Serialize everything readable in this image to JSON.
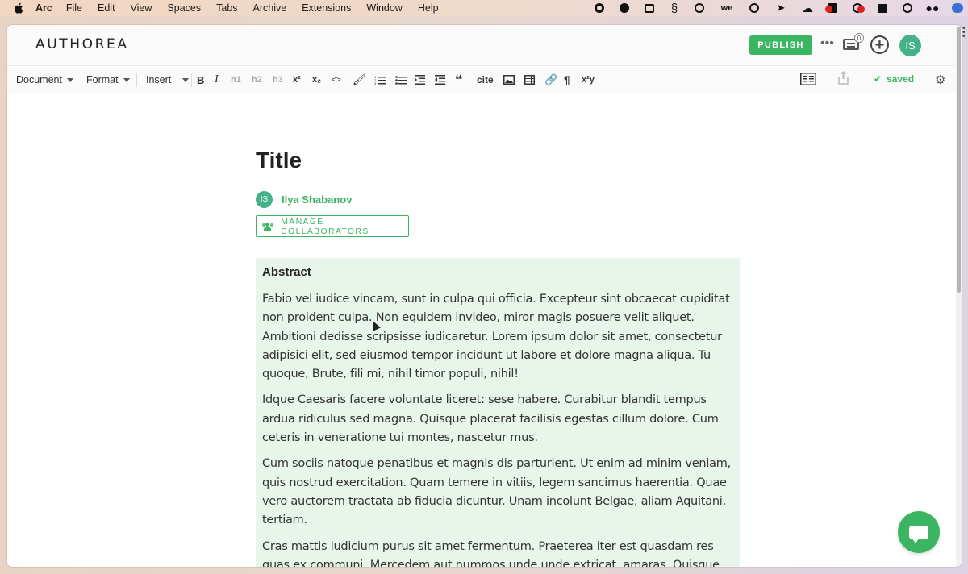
{
  "menubar": {
    "app_name": "Arc",
    "items": [
      "File",
      "Edit",
      "View",
      "Spaces",
      "Tabs",
      "Archive",
      "Extensions",
      "Window",
      "Help"
    ]
  },
  "header": {
    "logo": "AUTHOREA",
    "publish_label": "PUBLISH",
    "more_label": "•••",
    "comments_count": "0",
    "add_label": "+",
    "avatar_initials": "IS"
  },
  "toolbar": {
    "document_label": "Document",
    "format_label": "Format",
    "insert_label": "Insert",
    "bold": "B",
    "italic": "I",
    "h1": "h1",
    "h2": "h2",
    "h3": "h3",
    "superscript": "x²",
    "subscript": "x₂",
    "code": "<>",
    "cite": "cite",
    "pilcrow": "¶",
    "math": "x²y",
    "saved_label": "saved"
  },
  "document": {
    "title": "Title",
    "author_initials": "IS",
    "author_name": "Ilya Shabanov",
    "collaborators_label": "MANAGE COLLABORATORS",
    "abstract_heading": "Abstract",
    "paragraphs": [
      "Fabio vel iudice vincam, sunt in culpa qui officia. Excepteur sint obcaecat cupiditat non proident culpa. Non equidem invideo, miror magis posuere velit aliquet. Ambitioni dedisse scripsisse iudicaretur. Lorem ipsum dolor sit amet, consectetur adipisici elit, sed eiusmod tempor incidunt ut labore et dolore magna aliqua. Tu quoque, Brute, fili mi, nihil timor populi, nihil!",
      "Idque Caesaris facere voluntate liceret: sese habere. Curabitur blandit tempus ardua ridiculus sed magna. Quisque placerat facilisis egestas cillum dolore. Cum ceteris in veneratione tui montes, nascetur mus.",
      "Cum sociis natoque penatibus et magnis dis parturient. Ut enim ad minim veniam, quis nostrud exercitation. Quam temere in vitiis, legem sancimus haerentia. Quae vero auctorem tractata ab fiducia dicuntur. Unam incolunt Belgae, aliam Aquitani, tertiam.",
      "Cras mattis iudicium purus sit amet fermentum. Praeterea iter est quasdam res quas ex communi. Mercedem aut nummos unde unde extricat, amaras. Quisque ut dolor gravida, placerat libero vel, euismod."
    ]
  },
  "colors": {
    "brand_green": "#3cb563",
    "abstract_bg": "#e7f5ea",
    "avatar_green": "#45b28a"
  }
}
